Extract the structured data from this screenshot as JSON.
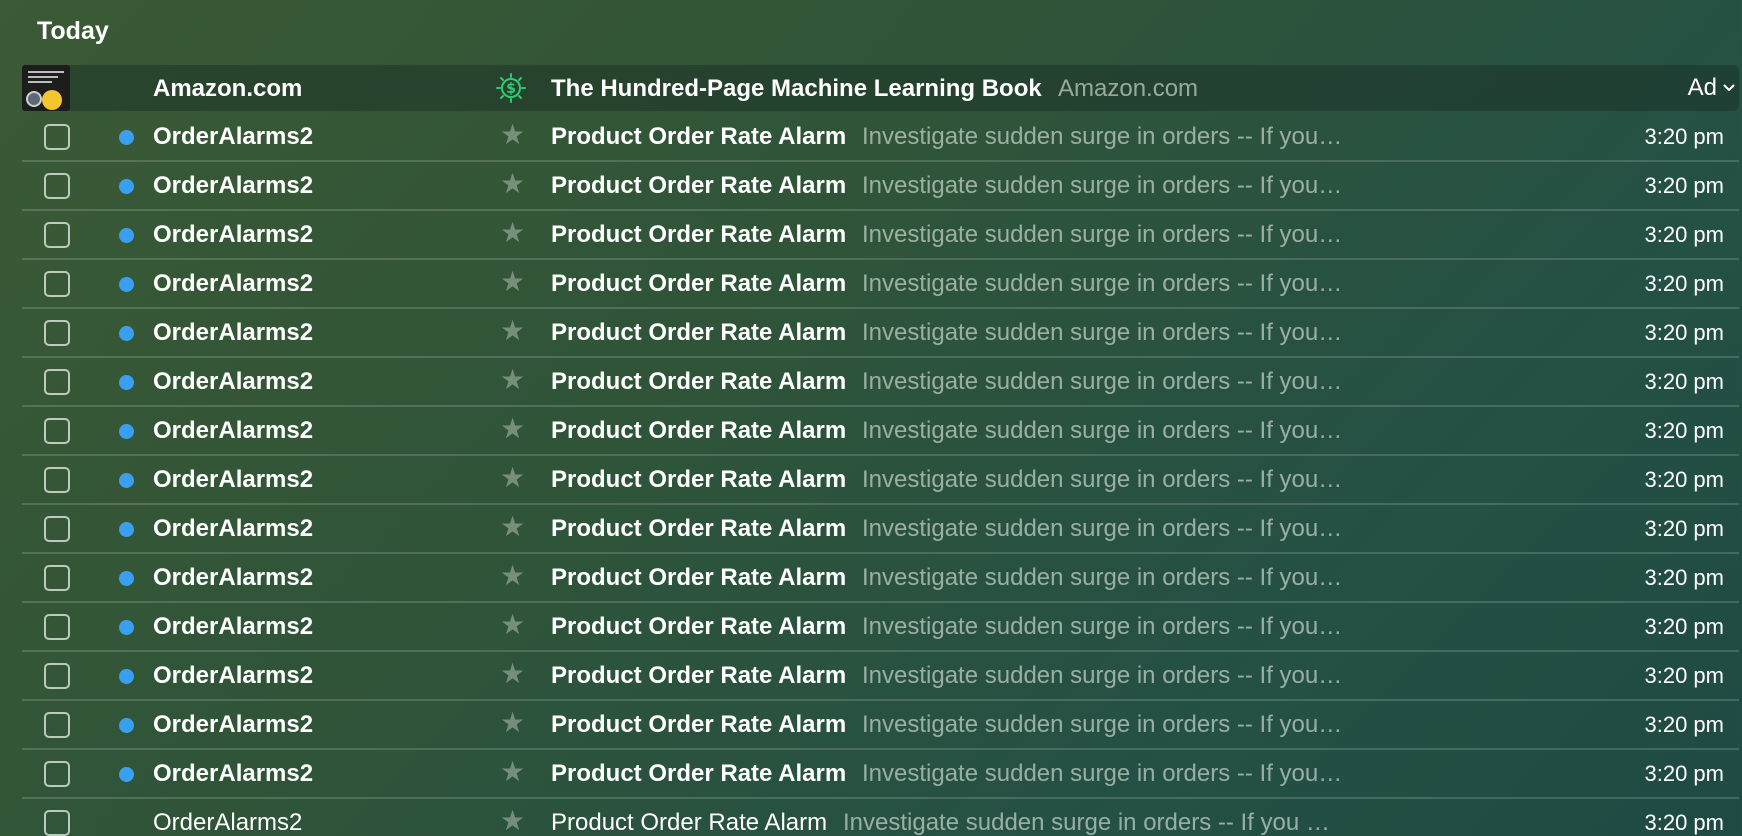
{
  "section": {
    "title": "Today"
  },
  "ad": {
    "sender": "Amazon.com",
    "subject": "The Hundred-Page Machine Learning Book",
    "snippet": "Amazon.com",
    "badge": "Ad",
    "thumbnail_icon": "book-cover-thumbnail",
    "sponsor_icon": "sponsored-dollar-icon"
  },
  "emails": [
    {
      "sender": "OrderAlarms2",
      "subject": "Product Order Rate Alarm",
      "snippet": "Investigate sudden surge in orders -- If you wish to unsubscribe from future notifications",
      "time": "3:20 pm",
      "unread": true
    },
    {
      "sender": "OrderAlarms2",
      "subject": "Product Order Rate Alarm",
      "snippet": "Investigate sudden surge in orders -- If you wish to unsubscribe from future notifications",
      "time": "3:20 pm",
      "unread": true
    },
    {
      "sender": "OrderAlarms2",
      "subject": "Product Order Rate Alarm",
      "snippet": "Investigate sudden surge in orders -- If you wish to unsubscribe from future notifications",
      "time": "3:20 pm",
      "unread": true
    },
    {
      "sender": "OrderAlarms2",
      "subject": "Product Order Rate Alarm",
      "snippet": "Investigate sudden surge in orders -- If you wish to unsubscribe from future notifications",
      "time": "3:20 pm",
      "unread": true
    },
    {
      "sender": "OrderAlarms2",
      "subject": "Product Order Rate Alarm",
      "snippet": "Investigate sudden surge in orders -- If you wish to unsubscribe from future notifications",
      "time": "3:20 pm",
      "unread": true
    },
    {
      "sender": "OrderAlarms2",
      "subject": "Product Order Rate Alarm",
      "snippet": "Investigate sudden surge in orders -- If you wish to unsubscribe from future notifications",
      "time": "3:20 pm",
      "unread": true
    },
    {
      "sender": "OrderAlarms2",
      "subject": "Product Order Rate Alarm",
      "snippet": "Investigate sudden surge in orders -- If you wish to unsubscribe from future notifications",
      "time": "3:20 pm",
      "unread": true
    },
    {
      "sender": "OrderAlarms2",
      "subject": "Product Order Rate Alarm",
      "snippet": "Investigate sudden surge in orders -- If you wish to unsubscribe from future notifications",
      "time": "3:20 pm",
      "unread": true
    },
    {
      "sender": "OrderAlarms2",
      "subject": "Product Order Rate Alarm",
      "snippet": "Investigate sudden surge in orders -- If you wish to unsubscribe from future notifications",
      "time": "3:20 pm",
      "unread": true
    },
    {
      "sender": "OrderAlarms2",
      "subject": "Product Order Rate Alarm",
      "snippet": "Investigate sudden surge in orders -- If you wish to unsubscribe from future notifications",
      "time": "3:20 pm",
      "unread": true
    },
    {
      "sender": "OrderAlarms2",
      "subject": "Product Order Rate Alarm",
      "snippet": "Investigate sudden surge in orders -- If you wish to unsubscribe from future notifications",
      "time": "3:20 pm",
      "unread": true
    },
    {
      "sender": "OrderAlarms2",
      "subject": "Product Order Rate Alarm",
      "snippet": "Investigate sudden surge in orders -- If you wish to unsubscribe from future notifications",
      "time": "3:20 pm",
      "unread": true
    },
    {
      "sender": "OrderAlarms2",
      "subject": "Product Order Rate Alarm",
      "snippet": "Investigate sudden surge in orders -- If you wish to unsubscribe from future notifications",
      "time": "3:20 pm",
      "unread": true
    },
    {
      "sender": "OrderAlarms2",
      "subject": "Product Order Rate Alarm",
      "snippet": "Investigate sudden surge in orders -- If you wish to unsubscribe from future notifications",
      "time": "3:20 pm",
      "unread": true
    },
    {
      "sender": "OrderAlarms2",
      "subject": "Product Order Rate Alarm",
      "snippet": "Investigate sudden surge in orders -- If you wish to unsubscribe from future notifications",
      "time": "3:20 pm",
      "unread": false
    }
  ],
  "colors": {
    "unread_dot": "#3a9ff0",
    "sponsor_icon": "#2ecc71"
  }
}
